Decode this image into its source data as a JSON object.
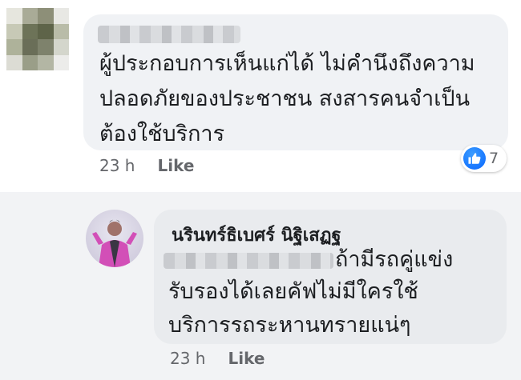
{
  "comment": {
    "text": "ผู้ประกอบการเห็นแก่ได้ ไม่คำนึงถึงความ\nปลอดภัยของประชาชน สงสารคนจำเป็น\nต้องใช้บริการ",
    "time": "23 h",
    "like_label": "Like",
    "reaction_count": "7",
    "reaction_icon": "like-thumb-icon",
    "accent": "#0866ff"
  },
  "reply": {
    "author": "นรินทร์ธิเบศร์ นิฐิเสฏฐ",
    "text_line1": "ถ้ามีรถคู่แข่ง",
    "text_rest": "รับรองได้เลยคัฟไม่มีใครใช้\nบริการรถระหานทรายแน่ๆ",
    "time": "23 h",
    "like_label": "Like"
  }
}
